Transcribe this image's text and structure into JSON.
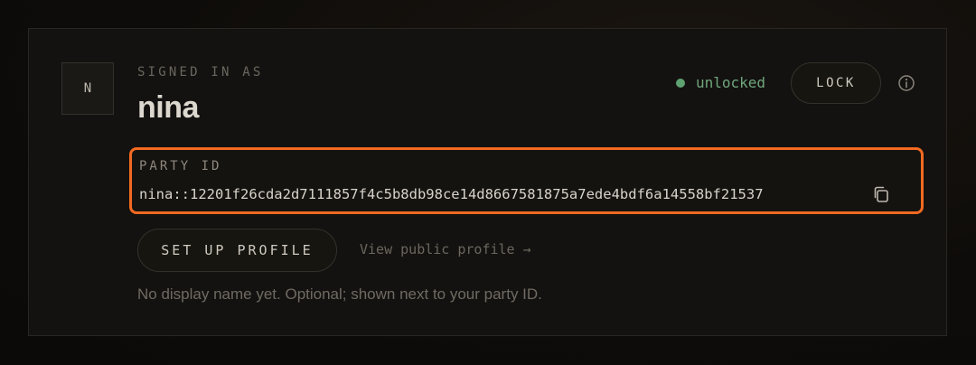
{
  "profile": {
    "avatar_initial": "N",
    "signed_in_label": "SIGNED IN AS",
    "username": "nina"
  },
  "status": {
    "text": "unlocked",
    "color": "#5fa271"
  },
  "actions": {
    "lock_label": "LOCK",
    "setup_profile_label": "SET UP PROFILE",
    "public_profile_link": "View public profile →"
  },
  "party": {
    "label": "PARTY ID",
    "value": "nina::12201f26cda2d7111857f4c5b8db98ce14d8667581875a7ede4bdf6a14558bf21537"
  },
  "helper_text": "No display name yet. Optional; shown next to your party ID.",
  "icons": {
    "info": "info-icon",
    "copy": "copy-icon"
  },
  "colors": {
    "highlight": "#f26a21",
    "background": "#141210"
  }
}
